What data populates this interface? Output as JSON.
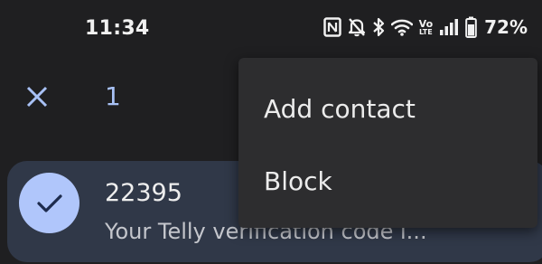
{
  "status_bar": {
    "time": "11:34",
    "battery_percent": "72%",
    "icons": [
      "nfc-icon",
      "notifications-off-icon",
      "bluetooth-icon",
      "wifi-icon",
      "volte-icon",
      "signal-icon",
      "battery-icon"
    ],
    "volte_label_top": "Vo",
    "volte_label_bottom": "LTE"
  },
  "toolbar": {
    "selected_count": "1"
  },
  "conversation": {
    "sender": "22395",
    "snippet": "Your Telly verification code i..."
  },
  "menu": {
    "items": [
      {
        "label": "Add contact"
      },
      {
        "label": "Block"
      }
    ]
  },
  "colors": {
    "background": "#1f1f21",
    "accent": "#a8c1f5",
    "avatar": "#b0c6fb",
    "row_highlight": "#303848",
    "menu_bg": "#2d2d2f"
  }
}
